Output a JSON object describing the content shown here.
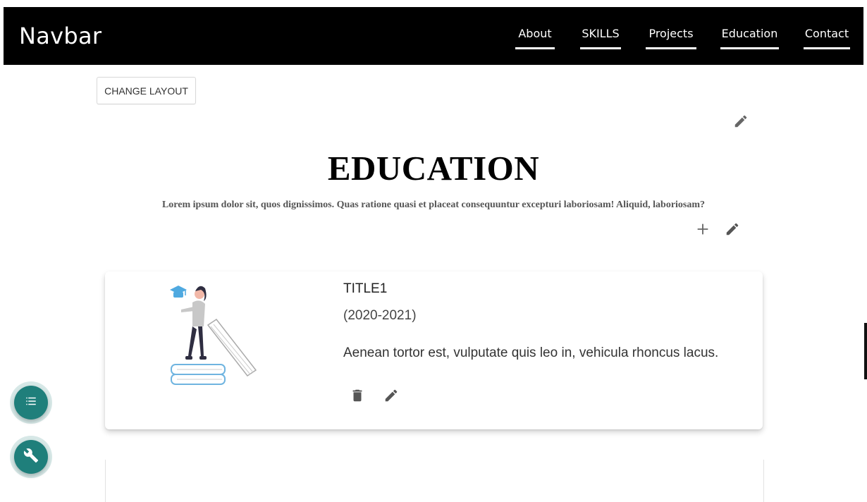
{
  "navbar": {
    "brand": "Navbar",
    "links": [
      "About",
      "SKILLS",
      "Projects",
      "Education",
      "Contact"
    ]
  },
  "toolbar": {
    "change_layout_label": "CHANGE LAYOUT"
  },
  "section": {
    "title": "EDUCATION",
    "subtitle": "Lorem ipsum dolor sit, quos dignissimos. Quas ratione quasi et placeat consequuntur excepturi laboriosam! Aliquid, laboriosam?"
  },
  "cards": [
    {
      "title": "TITLE1",
      "years": "(2020-2021)",
      "description": "Aenean tortor est, vulputate quis leo in, vehicula rhoncus lacus."
    }
  ],
  "icons": {
    "edit": "pencil-icon",
    "add": "plus-icon",
    "delete": "trash-icon",
    "list": "list-icon",
    "tools": "wrench-icon"
  },
  "colors": {
    "navbar_bg": "#000000",
    "fab_bg": "#1f7f7b",
    "icon_gray": "#666666"
  }
}
